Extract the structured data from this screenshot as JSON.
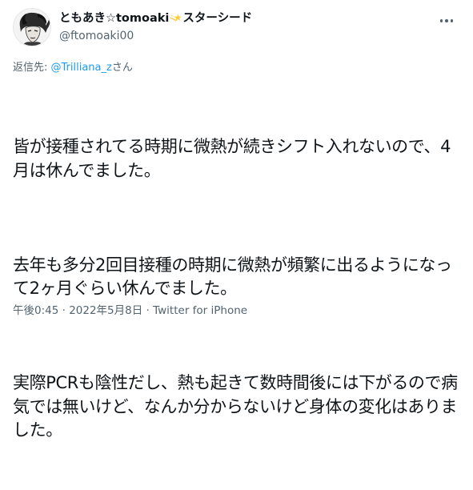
{
  "user": {
    "display_name_prefix": "ともあき☆tomoaki",
    "display_name_suffix": "スターシード",
    "handle": "@ftomoaki00",
    "badge_icon": "shooting-star-emoji"
  },
  "reply": {
    "prefix": "返信先: ",
    "mention": "@Trilliana_z",
    "suffix": "さん"
  },
  "tweet": {
    "paragraphs": [
      "皆が接種されてる時期に微熱が続きシフト入れないので、4月は休んでました。",
      "去年も多分2回目接種の時期に微熱が頻繁に出るようになって2ヶ月ぐらい休んでました。",
      "実際PCRも陰性だし、熱も起きて数時間後には下がるので病気では無いけど、なんか分からないけど身体の変化はありました。"
    ]
  },
  "meta": {
    "time": "午後0:45",
    "separator": " · ",
    "date": "2022年5月8日",
    "source": "Twitter for iPhone"
  },
  "colors": {
    "text": "#0f1419",
    "secondary": "#536471",
    "link": "#1d9bf0"
  }
}
